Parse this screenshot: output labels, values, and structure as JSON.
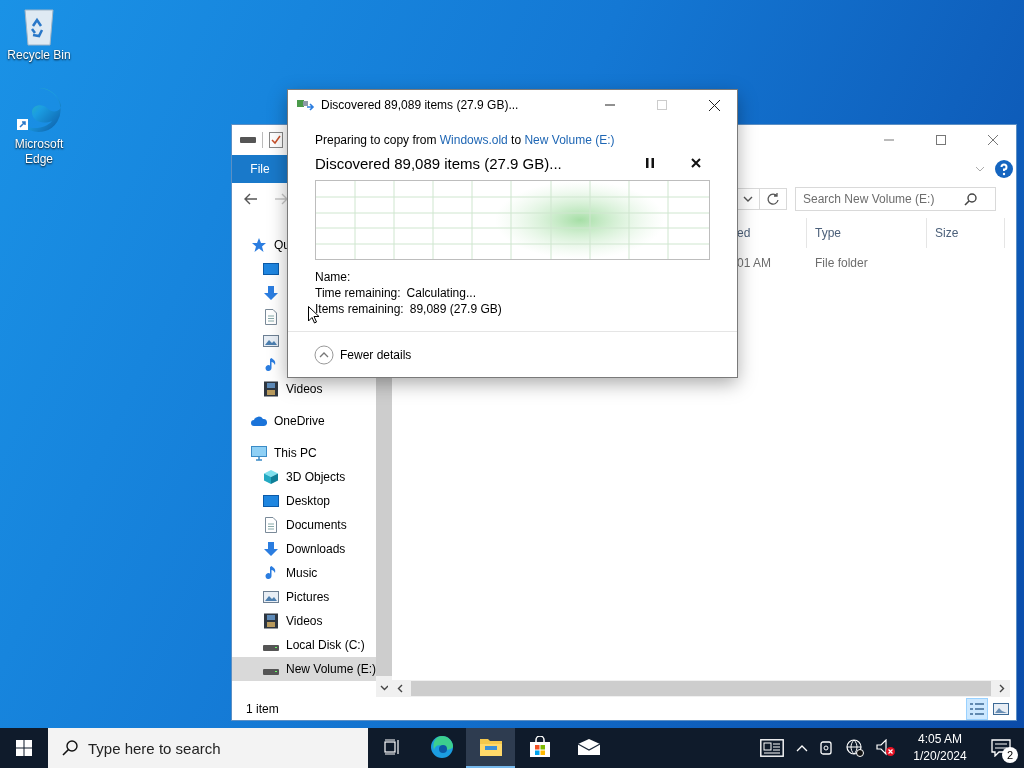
{
  "desktop_icons": [
    {
      "kind": "recycle",
      "label": "Recycle Bin"
    },
    {
      "kind": "edge",
      "label": "Microsoft Edge"
    }
  ],
  "explorer": {
    "file_tab": "File",
    "search": {
      "placeholder": "Search New Volume (E:)"
    },
    "columns": [
      "ed",
      "Type",
      "Size"
    ],
    "rows": [
      {
        "column_1": "01 AM",
        "type": "File folder"
      }
    ],
    "nav": [
      {
        "kind": "star",
        "label": "Qu",
        "selected": false,
        "children": [
          {
            "kind": "desktop",
            "selected": false
          },
          {
            "kind": "downloads",
            "selected": false
          },
          {
            "kind": "documents",
            "selected": false
          },
          {
            "kind": "pictures",
            "selected": false
          },
          {
            "kind": "music",
            "selected": false
          },
          {
            "kind": "videos",
            "label": "Videos",
            "selected": false
          }
        ]
      },
      {
        "kind": "cloud",
        "label": "OneDrive",
        "selected": false
      },
      {
        "kind": "pc",
        "label": "This PC",
        "selected": false,
        "children": [
          {
            "kind": "cube",
            "label": "3D Objects",
            "selected": false
          },
          {
            "kind": "desktop",
            "label": "Desktop",
            "selected": false
          },
          {
            "kind": "documents",
            "label": "Documents",
            "selected": false
          },
          {
            "kind": "downloads",
            "label": "Downloads",
            "selected": false
          },
          {
            "kind": "music",
            "label": "Music",
            "selected": false
          },
          {
            "kind": "pictures",
            "label": "Pictures",
            "selected": false
          },
          {
            "kind": "videos",
            "label": "Videos",
            "selected": false
          },
          {
            "kind": "disk",
            "label": "Local Disk (C:)",
            "selected": false
          },
          {
            "kind": "disk",
            "label": "New Volume (E:)",
            "selected": true
          }
        ]
      }
    ],
    "status": "1 item",
    "view_buttons": [
      {
        "kind": "details",
        "selected": true
      },
      {
        "kind": "tiles",
        "selected": false
      }
    ]
  },
  "copy_dialog": {
    "title": "Discovered 89,089 items (27.9 GB)...",
    "source_line": {
      "prefix": "Preparing to copy from",
      "source": "Windows.old",
      "middle": "to",
      "destination": "New Volume (E:)"
    },
    "heading": "Discovered 89,089 items (27.9 GB)...",
    "details": [
      {
        "label": "Name:"
      },
      {
        "label": "Time remaining:",
        "value": "Calculating..."
      },
      {
        "label": "Items remaining:",
        "value": "89,089 (27.9 GB)"
      }
    ],
    "toggle": "Fewer details"
  },
  "taskbar": {
    "search_placeholder": "Type here to search",
    "apps": [
      {
        "kind": "taskview",
        "active": false
      },
      {
        "kind": "edge",
        "active": false
      },
      {
        "kind": "explorer",
        "active": true
      },
      {
        "kind": "store",
        "active": false
      },
      {
        "kind": "mail",
        "active": false
      }
    ],
    "time": "4:05 AM",
    "date": "1/20/2024",
    "notifications": "2"
  }
}
